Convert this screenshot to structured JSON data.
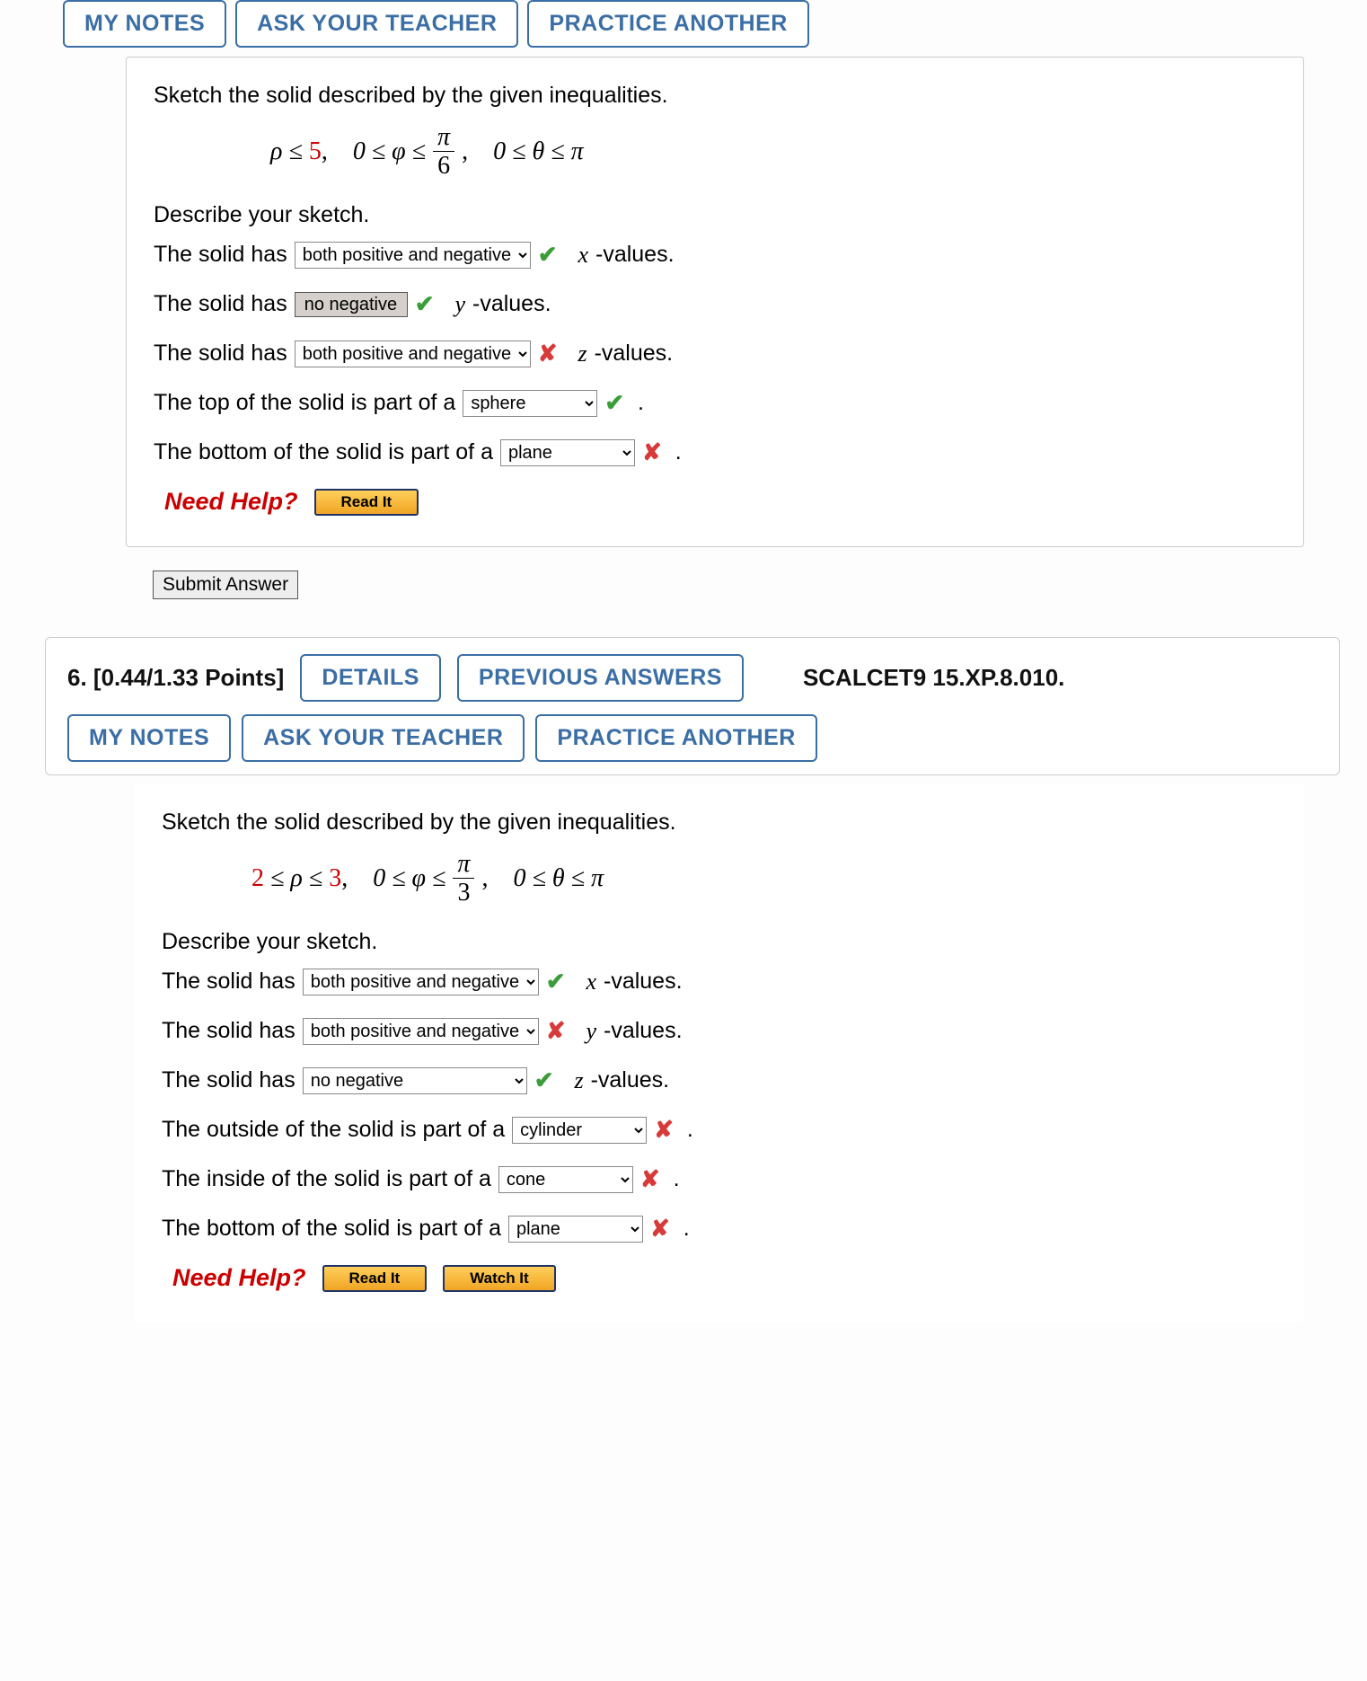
{
  "shared_buttons": {
    "my_notes": "MY NOTES",
    "ask_teacher": "ASK YOUR TEACHER",
    "practice_another": "PRACTICE ANOTHER",
    "details": "DETAILS",
    "previous_answers": "PREVIOUS ANSWERS"
  },
  "help": {
    "label": "Need Help?",
    "read_it": "Read It",
    "watch_it": "Watch It"
  },
  "submit_label": "Submit Answer",
  "marks": {
    "correct": "✔",
    "incorrect": "✘"
  },
  "q5": {
    "prompt": "Sketch the solid described by the given inequalities.",
    "ineq": {
      "rho_pre": "ρ ≤ ",
      "rho_val": "5",
      "rho_suf": ",",
      "phi_pre": "0 ≤ φ ≤",
      "phi_num": "π",
      "phi_den": "6",
      "phi_suf": ",",
      "theta": "0 ≤ θ ≤ π"
    },
    "subheader": "Describe your sketch.",
    "lines": {
      "l1_pre": "The solid has",
      "l1_sel": "both positive and negative",
      "l1_var": "x",
      "l1_suf": "-values.",
      "l1_mark": "correct",
      "l2_pre": "The solid has",
      "l2_sel": "no negative",
      "l2_var": "y",
      "l2_suf": "-values.",
      "l2_mark": "correct",
      "l3_pre": "The solid has",
      "l3_sel": "both positive and negative",
      "l3_var": "z",
      "l3_suf": "-values.",
      "l3_mark": "incorrect",
      "l4_pre": "The top of the solid is part of a",
      "l4_sel": "sphere",
      "l4_mark": "correct",
      "l5_pre": "The bottom of the solid is part of a",
      "l5_sel": "plane",
      "l5_mark": "incorrect"
    }
  },
  "q6": {
    "number_points": "6.  [0.44/1.33 Points]",
    "bookref": "SCALCET9 15.XP.8.010.",
    "prompt": "Sketch the solid described by the given inequalities.",
    "ineq": {
      "rho_lo": "2",
      "rho_between": " ≤ ρ ≤ ",
      "rho_hi": "3",
      "rho_suf": ",",
      "phi_pre": "0 ≤ φ ≤",
      "phi_num": "π",
      "phi_den": "3",
      "phi_suf": ",",
      "theta": "0 ≤ θ ≤ π"
    },
    "subheader": "Describe your sketch.",
    "lines": {
      "l1_pre": "The solid has",
      "l1_sel": "both positive and negative",
      "l1_var": "x",
      "l1_suf": "-values.",
      "l1_mark": "correct",
      "l2_pre": "The solid has",
      "l2_sel": "both positive and negative",
      "l2_var": "y",
      "l2_suf": "-values.",
      "l2_mark": "incorrect",
      "l3_pre": "The solid has",
      "l3_sel": "no negative",
      "l3_var": "z",
      "l3_suf": "-values.",
      "l3_mark": "correct",
      "l4_pre": "The outside of the solid is part of a",
      "l4_sel": "cylinder",
      "l4_mark": "incorrect",
      "l5_pre": "The inside of the solid is part of a",
      "l5_sel": "cone",
      "l5_mark": "incorrect",
      "l6_pre": "The bottom of the solid is part of a",
      "l6_sel": "plane",
      "l6_mark": "incorrect"
    }
  }
}
